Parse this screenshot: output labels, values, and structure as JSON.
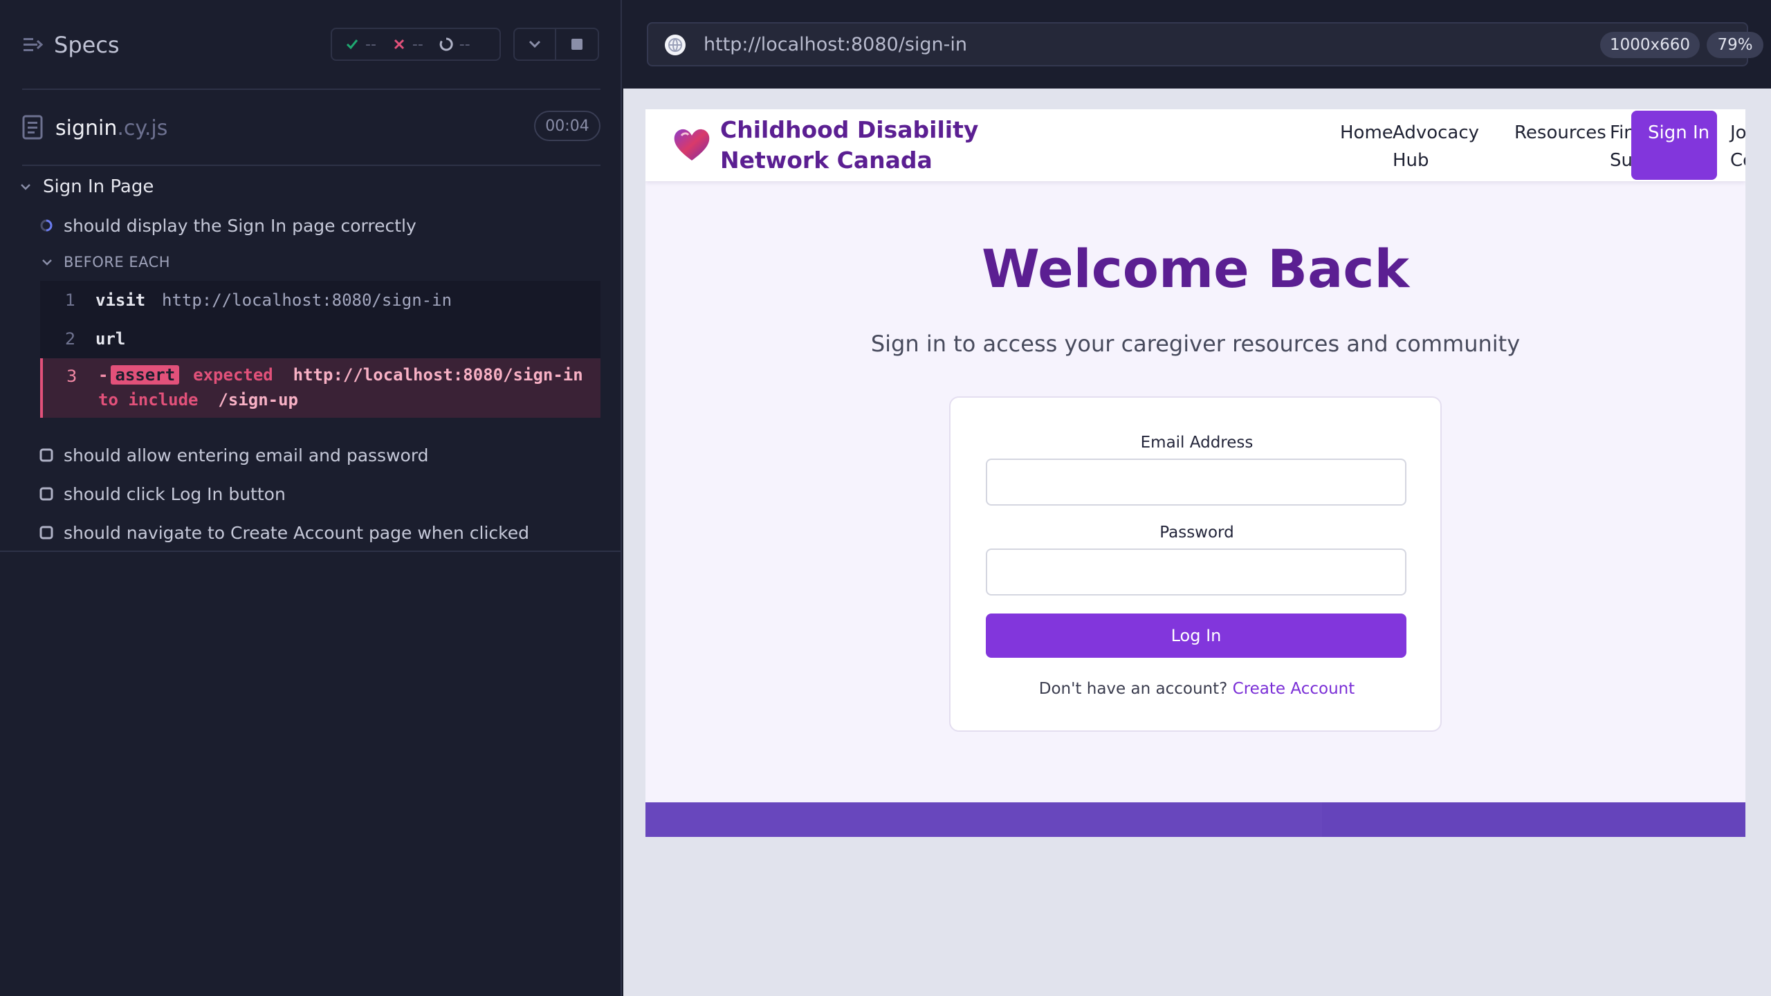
{
  "runner": {
    "specs_title": "Specs",
    "stats": {
      "passed": "--",
      "failed": "--",
      "pending": "--"
    },
    "file": {
      "name": "signin",
      "ext": ".cy.js",
      "duration": "00:04"
    },
    "suite": {
      "title": "Sign In Page"
    },
    "tests": [
      {
        "title": "should display the Sign In page correctly",
        "state": "running"
      },
      {
        "title": "should allow entering email and password",
        "state": "queued"
      },
      {
        "title": "should click Log In button",
        "state": "queued"
      },
      {
        "title": "should navigate to Create Account page when clicked",
        "state": "queued"
      }
    ],
    "hook_label": "BEFORE EACH",
    "commands": [
      {
        "num": "1",
        "name": "visit",
        "message": "http://localhost:8080/sign-in"
      },
      {
        "num": "2",
        "name": "url",
        "message": ""
      },
      {
        "num": "3",
        "name": "-",
        "badge": "assert",
        "expected_kw": "expected",
        "expected_val": "http://localhost:8080/sign-in",
        "include_kw": "to include",
        "include_val": "/sign-up"
      }
    ]
  },
  "aut": {
    "url": "http://localhost:8080/sign-in",
    "viewport": "1000x660",
    "zoom": "79%"
  },
  "app": {
    "brand": "Childhood Disability Network Canada",
    "nav": [
      "Home",
      "Advocacy Hub",
      "Resources",
      "Find Support",
      "Join Community"
    ],
    "nav_signin": "Sign In",
    "heading": "Welcome Back",
    "subtitle": "Sign in to access your caregiver resources and community",
    "email_label": "Email Address",
    "password_label": "Password",
    "login_button": "Log In",
    "signup_prompt": "Don't have an account?",
    "signup_link": "Create Account"
  },
  "colors": {
    "accent": "#8236dc",
    "brand": "#5b1f92",
    "fail": "#e2517a",
    "runner_bg": "#1b1e2e"
  }
}
